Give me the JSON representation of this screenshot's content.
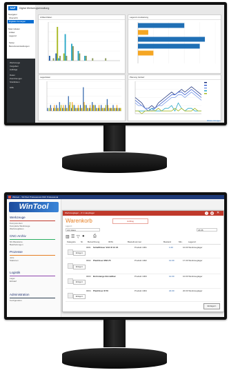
{
  "top_app": {
    "logo": "SAP",
    "title": "Digital Werkzeugverwaltung",
    "sidebar_sections": [
      {
        "label": "Navigator",
        "items": [
          "Übersicht",
          "Digitaler Anzeigen"
        ]
      },
      {
        "label": "Stammdaten",
        "items": [
          "Artikel",
          "Lagerort"
        ]
      },
      {
        "label": "",
        "items": [
          "Setup",
          "Benutzereinstellungen"
        ]
      }
    ],
    "sidebar_bottom": [
      "Werkzeuge",
      "Vorgaben",
      "Aufträge",
      "Daten",
      "Zuordnungen",
      "Stücklisten",
      "Hilfe"
    ],
    "panels": [
      {
        "title": "Artikel-Daten"
      },
      {
        "title": "Lagerort-Auslastung"
      },
      {
        "title": "Lagerdaten"
      },
      {
        "title": "Planung Verlauf"
      }
    ],
    "footer_link": "Weitere Anzeigen"
  },
  "chart_data": [
    {
      "type": "bar",
      "categories": [
        "A1",
        "A2",
        "A3",
        "A4",
        "A5",
        "A6",
        "A7",
        "A8",
        "A9",
        "A10",
        "A11"
      ],
      "series": [
        {
          "values": [
            2,
            3,
            0,
            0,
            0,
            0,
            0,
            0,
            0,
            0,
            0
          ],
          "color": "#1f5aa6"
        },
        {
          "values": [
            0,
            14,
            3,
            0,
            0,
            0,
            0,
            0,
            0,
            0,
            0
          ],
          "color": "#a8b820"
        },
        {
          "values": [
            0,
            1,
            11,
            7,
            4,
            2,
            0,
            0,
            0,
            0,
            0
          ],
          "color": "#2aa8c8"
        },
        {
          "values": [
            1,
            2,
            2,
            6,
            3,
            2,
            1,
            0,
            1,
            0,
            0
          ],
          "color": "#8b9a5b"
        }
      ],
      "ylim": [
        0,
        16
      ]
    },
    {
      "type": "bar",
      "orientation": "horizontal",
      "categories": [
        "R1",
        "R2",
        "R3",
        "R4",
        "R5",
        "R6"
      ],
      "values": [
        9,
        2,
        13,
        12,
        3,
        0
      ],
      "colors": [
        "#1f6fb5",
        "#f5a623",
        "#1f6fb5",
        "#1f6fb5",
        "#f5a623",
        "#f5a623"
      ],
      "xlim": [
        0,
        15
      ]
    },
    {
      "type": "bar",
      "categories": [
        "1",
        "2",
        "3",
        "4",
        "5",
        "6",
        "7",
        "8",
        "9",
        "10",
        "11",
        "12",
        "13",
        "14",
        "15",
        "16",
        "17",
        "18",
        "19",
        "20",
        "21",
        "22",
        "23",
        "24",
        "25"
      ],
      "series": [
        {
          "values": [
            1,
            2,
            1,
            2,
            3,
            1,
            2,
            5,
            1,
            2,
            1,
            2,
            8,
            2,
            1,
            3,
            2,
            1,
            2,
            1,
            4,
            1,
            2,
            1,
            1
          ],
          "color": "#1f5aa6"
        },
        {
          "values": [
            0,
            1,
            2,
            1,
            1,
            2,
            1,
            2,
            3,
            1,
            2,
            1,
            3,
            1,
            2,
            2,
            1,
            2,
            1,
            1,
            2,
            1,
            1,
            2,
            1
          ],
          "color": "#f5a623"
        },
        {
          "values": [
            1,
            0,
            1,
            1,
            2,
            1,
            1,
            3,
            2,
            1,
            1,
            1,
            2,
            1,
            1,
            2,
            1,
            1,
            1,
            2,
            1,
            1,
            1,
            1,
            1
          ],
          "color": "#a8b820"
        }
      ],
      "ylim": [
        0,
        10
      ]
    },
    {
      "type": "line",
      "x": [
        0,
        1,
        2,
        3,
        4,
        5,
        6,
        7,
        8,
        9,
        10,
        11,
        12,
        13,
        14,
        15,
        16,
        17,
        18,
        19,
        20
      ],
      "series": [
        {
          "values": [
            6,
            5,
            4,
            2,
            2,
            3,
            2,
            4,
            5,
            6,
            7,
            8,
            7,
            8,
            9,
            8,
            9,
            10,
            9,
            8,
            7
          ],
          "color": "#1a2f7a"
        },
        {
          "values": [
            5,
            4,
            3,
            2,
            1,
            2,
            2,
            3,
            4,
            5,
            6,
            7,
            7,
            8,
            8,
            7,
            8,
            9,
            8,
            7,
            6
          ],
          "color": "#3b5fd0"
        },
        {
          "values": [
            4,
            3,
            3,
            2,
            2,
            1,
            2,
            3,
            3,
            4,
            5,
            6,
            6,
            7,
            7,
            6,
            7,
            8,
            7,
            6,
            5
          ],
          "color": "#7a9be8"
        },
        {
          "values": [
            1,
            1,
            1,
            1,
            1,
            2,
            1,
            1,
            1,
            2,
            2,
            3,
            1,
            4,
            2,
            1,
            2,
            2,
            1,
            1,
            1
          ],
          "color": "#2aa8c8"
        },
        {
          "values": [
            1,
            1,
            0,
            1,
            1,
            1,
            1,
            2,
            1,
            1,
            1,
            1,
            2,
            1,
            2,
            1,
            1,
            1,
            2,
            1,
            1
          ],
          "color": "#a8b820"
        }
      ],
      "legend": "right",
      "ylim": [
        0,
        12
      ]
    }
  ],
  "wintool": {
    "window_title": "Wintool – WinTool Professional 2016 Professional",
    "logo": "WinTool",
    "sections": [
      {
        "title": "Werkzeuge",
        "items": [
          "Komponenten",
          "Komplette Werkzeuge",
          "Werkzeuglisten"
        ],
        "color": "#c0392b"
      },
      {
        "title": "CNC-Archiv",
        "items": [
          "NC-Bausteine",
          "Bearbeitungen"
        ],
        "color": "#27ae60"
      },
      {
        "title": "Prozesse",
        "items": [
          "Jobs",
          "Stationen"
        ],
        "color": "#e67e22"
      },
      {
        "title": "Logistik",
        "items": [
          "Lager",
          "Einkauf"
        ],
        "color": "#8e44ad"
      },
      {
        "title": "Administration",
        "items": [
          "Konfiguration"
        ],
        "color": "#2c3e50"
      }
    ],
    "dialog_title": "Werkzeuglager – 0 1 Hauptlager",
    "dialog_heading": "Warenkorb",
    "dialog_tab": "Auftrag",
    "field_label": "Lagerort",
    "field_value": "L01 Haus",
    "date_value": "18.06",
    "dialog_button": "Einlagern",
    "columns": [
      "Kategorie",
      "Nr.",
      "Bezeichnung",
      "ID/Nr.",
      "Bauteilnummer",
      "Bestand",
      "Min.",
      "Lagerort"
    ],
    "rows": [
      {
        "nr": "0001",
        "name": "Schaftfräser VHC Ø 12 Z4",
        "part": "Produkt 1001",
        "qty": "1.00",
        "loc": "10.00  Werkzeuglager"
      },
      {
        "nr": "0002",
        "name": "Planfräser Ø63 Z5",
        "part": "Produkt 1002",
        "qty": "12.00",
        "loc": "17.00  Werkzeuglager"
      },
      {
        "nr": "0003",
        "name": "Bohrstange Einstellbar",
        "part": "Produkt 1003",
        "qty": "12.00",
        "loc": "10.00  Werkzeuglager"
      },
      {
        "nr": "0004",
        "name": "Planfräser Ø 50",
        "part": "Produkt 1004",
        "qty": "22.00",
        "loc": "20.00  Werkzeuglager"
      }
    ],
    "row_button": "Einlagern",
    "ok_button": "Einlagern"
  }
}
